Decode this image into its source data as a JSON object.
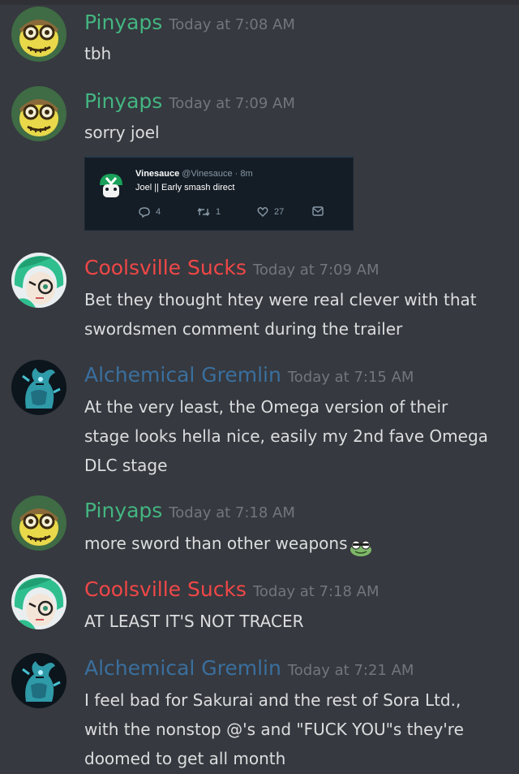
{
  "colors": {
    "background": "#36393f",
    "pinyaps": "#43b581",
    "coolsville": "#f04747",
    "gremlin": "#3a6f9e",
    "text": "#dcddde",
    "timestamp": "#72767d"
  },
  "messages": [
    {
      "author": "Pinyaps",
      "timestamp": "Today at 7:08 AM",
      "text": "tbh",
      "avatar": "helmet-skull-avatar"
    },
    {
      "author": "Pinyaps",
      "timestamp": "Today at 7:09 AM",
      "text": "sorry joel",
      "avatar": "helmet-skull-avatar",
      "embed": {
        "account_name": "Vinesauce",
        "handle": "@Vinesauce · 8m",
        "text": "Joel || Early smash direct",
        "replies": "4",
        "retweets": "1",
        "likes": "27"
      }
    },
    {
      "author": "Coolsville Sucks",
      "timestamp": "Today at 7:09 AM",
      "text_lines": [
        "Bet they thought htey were real clever with that",
        "swordsmen comment during the trailer"
      ],
      "avatar": "green-hair-avatar"
    },
    {
      "author": "Alchemical Gremlin",
      "timestamp": "Today at 7:15 AM",
      "text_lines": [
        "At the very least, the Omega version of their",
        "stage looks hella nice, easily my 2nd fave Omega",
        "DLC stage"
      ],
      "avatar": "dragon-avatar"
    },
    {
      "author": "Pinyaps",
      "timestamp": "Today at 7:18 AM",
      "text": "more sword than other weapons",
      "emoji": "frog-emoji",
      "avatar": "helmet-skull-avatar"
    },
    {
      "author": "Coolsville Sucks",
      "timestamp": "Today at 7:18 AM",
      "text": "AT LEAST IT'S NOT TRACER",
      "avatar": "green-hair-avatar"
    },
    {
      "author": "Alchemical Gremlin",
      "timestamp": "Today at 7:21 AM",
      "text_lines": [
        "I feel bad for Sakurai and the rest of Sora Ltd.,",
        "with the nonstop @'s and \"FUCK YOU\"s they're",
        "doomed to get all month"
      ],
      "avatar": "dragon-avatar"
    }
  ]
}
